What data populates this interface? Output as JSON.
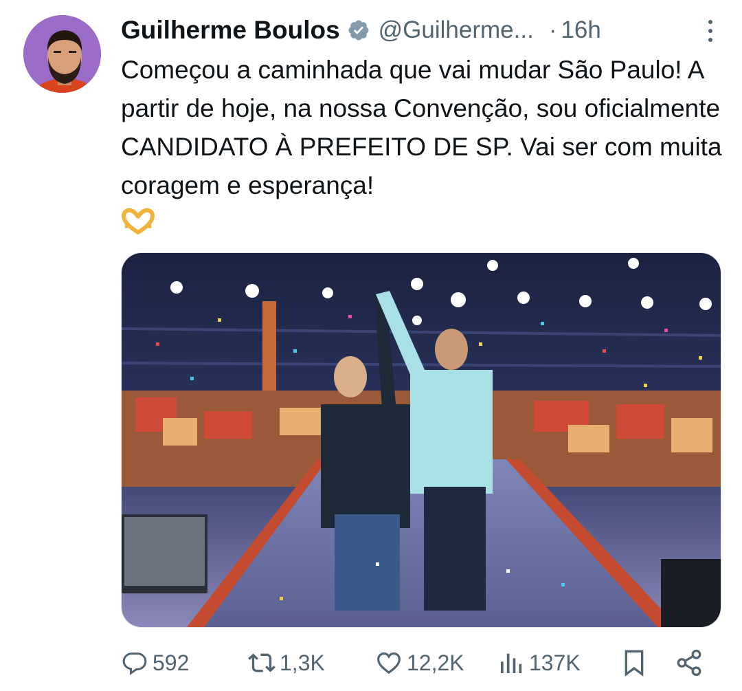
{
  "tweet": {
    "author_name": "Guilherme Boulos",
    "handle": "@Guilherme...",
    "dot": "·",
    "time": "16h",
    "text": "Começou a caminhada que vai mudar São Paulo! A partir de hoje, na nossa Convenção, sou oficialmente CANDIDATO À PREFEITO DE SP. Vai ser com muita coragem e esperança!",
    "emoji": "heart-hands-emoji",
    "verified_icon": "verified-badge-icon",
    "more_icon": "more-vertical-icon"
  },
  "actions": {
    "replies": "592",
    "reposts": "1,3K",
    "likes": "12,2K",
    "views": "137K"
  },
  "icons": {
    "reply": "reply-icon",
    "repost": "repost-icon",
    "like": "like-icon",
    "views": "views-icon",
    "bookmark": "bookmark-icon",
    "share": "share-icon"
  },
  "colors": {
    "text": "#0f1419",
    "secondary": "#536471",
    "avatar_bg": "#9a6cc7",
    "verified": "#829aab"
  }
}
